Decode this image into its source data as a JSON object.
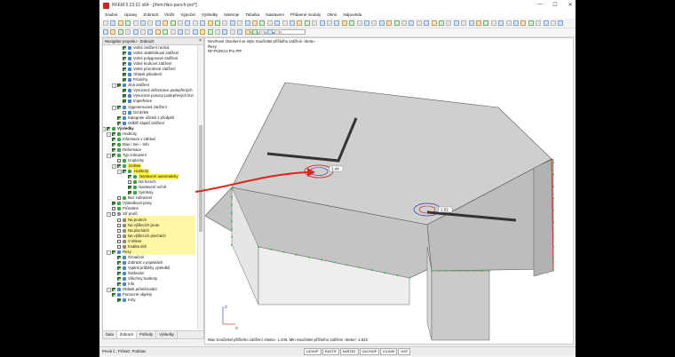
{
  "window": {
    "title": "RFEM 5.23.01 x64 - [rfem-files-punch-pro*]",
    "controls": [
      "—",
      "☐",
      "✕"
    ]
  },
  "menu": [
    "Soubor",
    "Úpravy",
    "Zobrazit",
    "Vložit",
    "Výpočet",
    "Výsledky",
    "Nástroje",
    "Tabulka",
    "Nastavení",
    "Přídavné moduly",
    "Okno",
    "Nápověda"
  ],
  "toolbar": {
    "loadcase_combo": "RF-PUNCH Pro PP!"
  },
  "navigator": {
    "title": "Navigátor projektu - Zobrazit",
    "tabs": [
      "Data",
      "Zobrazit",
      "Pohledy",
      "Výsledky"
    ],
    "active_tab": "Zobrazit",
    "items": [
      {
        "label": "Volné zatížení na linii",
        "cb": true
      },
      {
        "label": "Volné obdélníkové zatížení",
        "cb": true
      },
      {
        "label": "Volné polygonové zatížení",
        "cb": true
      },
      {
        "label": "Volné kruhové zatížení",
        "cb": true
      },
      {
        "label": "Volné proměnné zatížení",
        "cb": true
      },
      {
        "label": "Oblasti působení",
        "cb": true
      },
      {
        "label": "Průměry",
        "cb": true
      },
      {
        "label": "Jiná zatížení",
        "cb": true
      },
      {
        "label": "Vynucené deformace podepřených",
        "cb": true
      },
      {
        "label": "Vynucené posuny podepřených linií",
        "cb": true
      },
      {
        "label": "Imperfekce",
        "cb": true
      },
      {
        "label": "Vygenerovaná zatížení",
        "cb": true
      },
      {
        "label": "Od délek",
        "cb": false
      },
      {
        "label": "Kategorie účinků z předpětí",
        "cb": true
      },
      {
        "label": "Odkliž zápatí zatížení",
        "cb": true
      },
      {
        "label": "Výsledky",
        "cb": true
      },
      {
        "label": "Hodnoty",
        "cb": true
      },
      {
        "label": "Informace v záhlaví",
        "cb": true
      },
      {
        "label": "Max / min - Info",
        "cb": true
      },
      {
        "label": "Deformace",
        "cb": true
      },
      {
        "label": "Typ zobrazení",
        "cb": true
      },
      {
        "label": "Izoplochy",
        "cb": false
      },
      {
        "label": "Izolinie",
        "cb": true
      },
      {
        "label": "Hodnoty",
        "cb": true
      },
      {
        "label": "Nastavení automaticky",
        "cb": true
      },
      {
        "label": "Na řezech",
        "cb": false
      },
      {
        "label": "Nastavení ručně",
        "cb": true
      },
      {
        "label": "Symboly",
        "cb": true
      },
      {
        "label": "Bez zobrazení",
        "cb": false
      },
      {
        "label": "Výsledkové pruty",
        "cb": true
      },
      {
        "label": "Průsvitné",
        "cb": false
      },
      {
        "label": "Síť prutů",
        "cb": false
      },
      {
        "label": "Na prutech",
        "cb": false
      },
      {
        "label": "Na výšlecích prutu",
        "cb": false
      },
      {
        "label": "Na plochách",
        "cb": false
      },
      {
        "label": "Na výšlecích plochách",
        "cb": false
      },
      {
        "label": "V tělese",
        "cb": false
      },
      {
        "label": "Kvalita sítě",
        "cb": false
      },
      {
        "label": "Řezy",
        "cb": true
      },
      {
        "label": "Označení",
        "cb": true
      },
      {
        "label": "Zobrazit v popiskách",
        "cb": true
      },
      {
        "label": "Vyplnit průběhy výsledků",
        "cb": true
      },
      {
        "label": "Šrafování",
        "cb": true
      },
      {
        "label": "Všechny hodnoty",
        "cb": true
      },
      {
        "label": "Info",
        "cb": true
      },
      {
        "label": "Oblasti průměrování",
        "cb": true
      },
      {
        "label": "Pomocné objekty",
        "cb": true
      },
      {
        "label": "Kóty",
        "cb": true
      }
    ]
  },
  "viewport": {
    "info": [
      "Nevrhové zkoušení ve stylu Součinitel příčkého zatížení «beta»",
      "Řezy",
      "RF-PUNCH Pro PP!"
    ],
    "labels": [
      "1.44",
      "1.52"
    ],
    "axis": {
      "x": "X",
      "z": "Z"
    },
    "result_line": "Max Součinitel příčkého zatížení «beta»: 1.446, Min Součinitel příčkého zatížení «beta»: 1.522"
  },
  "status": {
    "text": "Prvek č.: Průsez: Podstav",
    "buttons": [
      "UCHOP",
      "RASTR",
      "KARTEZ",
      "OUCHOP",
      "ICLINIE",
      "DXF"
    ]
  },
  "colors": {
    "accent_red": "#e0231c",
    "highlight_yellow": "#fff24a",
    "check_green": "#3b7d33",
    "surface_gray": "#c9c9c9"
  }
}
